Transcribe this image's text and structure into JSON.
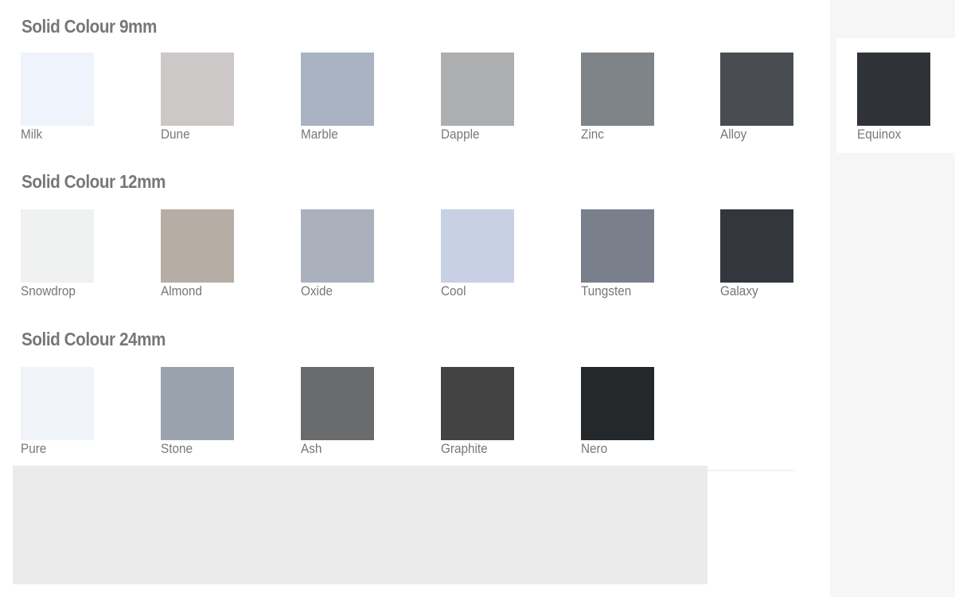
{
  "sections": [
    {
      "title": "Solid Colour 9mm",
      "swatches": [
        {
          "name": "Milk",
          "color": "#eef3fc"
        },
        {
          "name": "Dune",
          "color": "#cbc8c7"
        },
        {
          "name": "Marble",
          "color": "#a9b3c1"
        },
        {
          "name": "Dapple",
          "color": "#adaeaf"
        },
        {
          "name": "Zinc",
          "color": "#7f8489"
        },
        {
          "name": "Alloy",
          "color": "#494d52"
        },
        {
          "name": "Equinox",
          "color": "#2f3338"
        }
      ]
    },
    {
      "title": "Solid Colour 12mm",
      "swatches": [
        {
          "name": "Snowdrop",
          "color": "#f0f1f1"
        },
        {
          "name": "Almond",
          "color": "#b6ada5"
        },
        {
          "name": "Oxide",
          "color": "#aab1bd"
        },
        {
          "name": "Cool",
          "color": "#c8d0e3"
        },
        {
          "name": "Tungsten",
          "color": "#7a808b"
        },
        {
          "name": "Galaxy",
          "color": "#33373d"
        }
      ]
    },
    {
      "title": "Solid Colour 24mm",
      "swatches": [
        {
          "name": "Pure",
          "color": "#f0f3f7"
        },
        {
          "name": "Stone",
          "color": "#9aa3ad"
        },
        {
          "name": "Ash",
          "color": "#696b6d"
        },
        {
          "name": "Graphite",
          "color": "#434343"
        },
        {
          "name": "Nero",
          "color": "#24282b"
        }
      ]
    }
  ]
}
